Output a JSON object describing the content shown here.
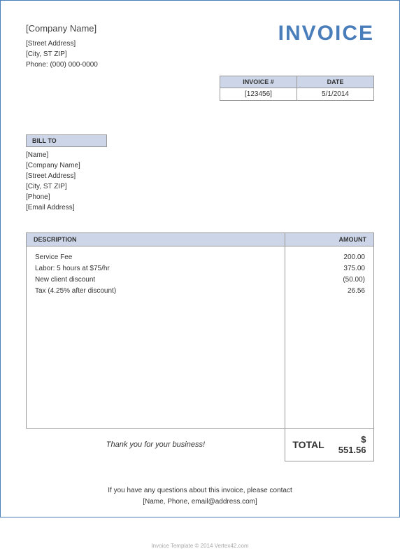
{
  "header": {
    "company_name": "[Company Name]",
    "street": "[Street Address]",
    "city_line": "[City, ST  ZIP]",
    "phone_line": "Phone: (000) 000-0000",
    "title": "INVOICE"
  },
  "meta": {
    "invoice_header": "INVOICE #",
    "date_header": "DATE",
    "invoice_number": "[123456]",
    "date": "5/1/2014"
  },
  "billto": {
    "header": "BILL TO",
    "name": "[Name]",
    "company": "[Company Name]",
    "street": "[Street Address]",
    "city_line": "[City, ST  ZIP]",
    "phone": "[Phone]",
    "email": "[Email Address]"
  },
  "columns": {
    "description": "DESCRIPTION",
    "amount": "AMOUNT"
  },
  "items": [
    {
      "desc": "Service Fee",
      "amount": "200.00"
    },
    {
      "desc": "Labor: 5 hours at $75/hr",
      "amount": "375.00"
    },
    {
      "desc": "New client discount",
      "amount": "(50.00)"
    },
    {
      "desc": "Tax (4.25% after discount)",
      "amount": "26.56"
    }
  ],
  "thanks": "Thank you for your business!",
  "total_label": "TOTAL",
  "total_value": "$ 551.56",
  "footer": {
    "line1": "If you have any questions about this invoice, please contact",
    "line2": "[Name, Phone, email@address.com]"
  },
  "credit": "Invoice Template  © 2014 Vertex42.com"
}
